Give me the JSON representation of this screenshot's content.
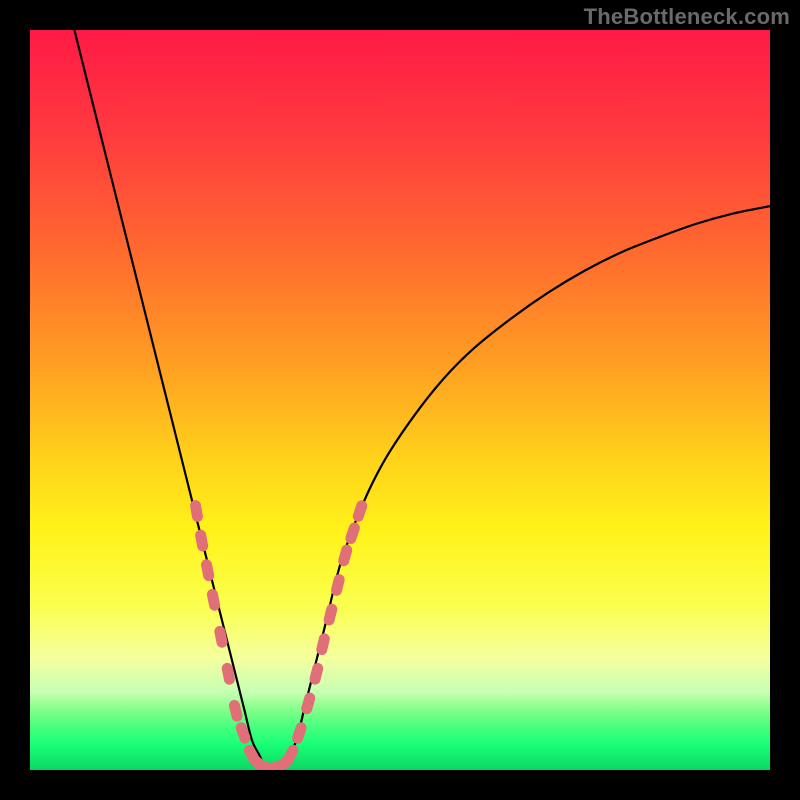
{
  "watermark": "TheBottleneck.com",
  "colors": {
    "bg": "#000000",
    "curve": "#000000",
    "marker": "#e16f78",
    "gradient_stops": [
      {
        "offset": 0.0,
        "color": "#ff1a46"
      },
      {
        "offset": 0.14,
        "color": "#ff3a3f"
      },
      {
        "offset": 0.3,
        "color": "#ff6a2f"
      },
      {
        "offset": 0.45,
        "color": "#ff9e22"
      },
      {
        "offset": 0.58,
        "color": "#ffd21a"
      },
      {
        "offset": 0.68,
        "color": "#fff31a"
      },
      {
        "offset": 0.78,
        "color": "#fbff50"
      },
      {
        "offset": 0.85,
        "color": "#f4ffa0"
      },
      {
        "offset": 0.895,
        "color": "#c6ffb3"
      },
      {
        "offset": 0.915,
        "color": "#8cff8c"
      },
      {
        "offset": 0.94,
        "color": "#4bff7f"
      },
      {
        "offset": 0.965,
        "color": "#1aff77"
      },
      {
        "offset": 1.0,
        "color": "#0bd763"
      }
    ]
  },
  "chart_data": {
    "type": "line",
    "title": "",
    "xlabel": "",
    "ylabel": "",
    "xlim": [
      0,
      100
    ],
    "ylim": [
      0,
      100
    ],
    "grid": false,
    "series": [
      {
        "name": "bottleneck-curve",
        "x": [
          6,
          8,
          10,
          12,
          14,
          16,
          18,
          20,
          22,
          24,
          25,
          26,
          27,
          28,
          29,
          30,
          31,
          32,
          33,
          34,
          35,
          36,
          37,
          38,
          40,
          42,
          45,
          48,
          52,
          56,
          60,
          65,
          70,
          75,
          80,
          85,
          90,
          95,
          100
        ],
        "y": [
          100,
          92,
          84,
          76,
          68,
          60,
          52,
          44,
          36,
          28,
          24,
          20,
          16,
          12,
          8,
          4,
          2,
          0,
          0,
          0,
          2,
          4,
          8,
          12,
          20,
          28,
          36,
          42,
          48,
          53,
          57,
          61,
          64.5,
          67.5,
          70,
          72,
          73.8,
          75.2,
          76.2
        ]
      }
    ],
    "markers": [
      {
        "x": 22.5,
        "y": 35
      },
      {
        "x": 23.2,
        "y": 31
      },
      {
        "x": 24.0,
        "y": 27
      },
      {
        "x": 24.8,
        "y": 23
      },
      {
        "x": 25.8,
        "y": 18
      },
      {
        "x": 26.8,
        "y": 13
      },
      {
        "x": 27.8,
        "y": 8
      },
      {
        "x": 28.8,
        "y": 5
      },
      {
        "x": 30.0,
        "y": 2
      },
      {
        "x": 31.0,
        "y": 0.8
      },
      {
        "x": 32.0,
        "y": 0.3
      },
      {
        "x": 33.0,
        "y": 0.3
      },
      {
        "x": 34.2,
        "y": 0.8
      },
      {
        "x": 35.2,
        "y": 2
      },
      {
        "x": 36.4,
        "y": 5
      },
      {
        "x": 37.6,
        "y": 9
      },
      {
        "x": 38.7,
        "y": 13
      },
      {
        "x": 39.6,
        "y": 17
      },
      {
        "x": 40.6,
        "y": 21
      },
      {
        "x": 41.6,
        "y": 25
      },
      {
        "x": 42.6,
        "y": 29
      },
      {
        "x": 43.6,
        "y": 32
      },
      {
        "x": 44.6,
        "y": 35
      }
    ]
  }
}
